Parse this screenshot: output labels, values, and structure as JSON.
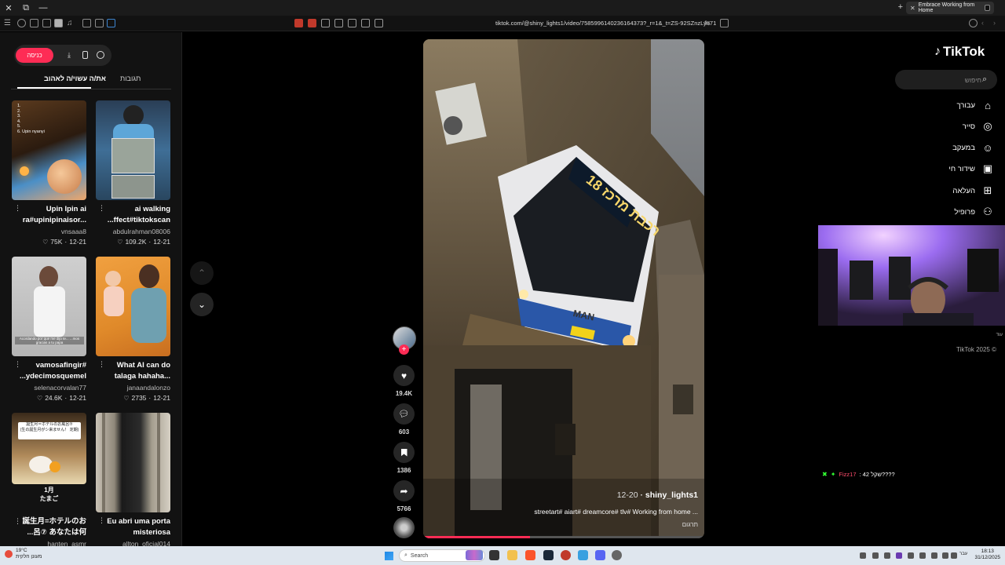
{
  "browser": {
    "tab_title": "Embrace Working from Home",
    "url": "tiktok.com/@shiny_lights1/video/7585996140236164373?_r=1&_t=ZS-92SZnzLyn71"
  },
  "sidebar_left": {
    "login_label": "כניסה",
    "tabs": {
      "liked": "את/ה עשוי/ה לאהוב",
      "replies": "תגובות"
    },
    "cards": [
      {
        "title1": "Upin Ipin ai",
        "title2": "ra#upinipinaisor...",
        "author": "vnsaaa8",
        "date": "12-21",
        "likes": "75K",
        "thumb_text": "1.\n2.\n3.\n4.\n5.\n6. Upin nyanyi"
      },
      {
        "title1": "ai walking",
        "title2": "...ffect#tiktokscan",
        "author": "abdulrahman08006",
        "date": "12-21",
        "likes": "109.2K"
      },
      {
        "title1": "vamosafingir#",
        "title2": "...ydecimosquemel",
        "author": "selenacorvalan77",
        "date": "12-21",
        "likes": "24.6K",
        "thumb_text": "Acordando por que me dijo te... ...mos gracias a tu papa"
      },
      {
        "title1": "What AI can do",
        "title2": "talaga hahaha...",
        "author": "janaandalonzo",
        "date": "12-21",
        "likes": "2735"
      },
      {
        "title1": "1月",
        "title2": "たまご",
        "author": "",
        "date": "",
        "likes": "",
        "thumb_text": "誕生月＝ホテルのお風呂⑦\n(生の誕生月がシ来ません！ 定期)"
      },
      {
        "title1": "Eu abri uma porta",
        "title2": "misteriosa",
        "author": "allton_oficial014",
        "date": "",
        "likes": ""
      },
      {
        "title1": "誕生月=ホテルのお",
        "title2": "...呂⑦ あなたは何",
        "author": "hanten_asmr",
        "date": "",
        "likes": ""
      }
    ]
  },
  "video": {
    "author": "shiny_lights1",
    "date": "12-20",
    "description": "streetart# aiart# dreamcore# tlv# Working from home ...",
    "translate": "תרגום",
    "bus_sign": "18 רכבת מרכז",
    "progress": 0.38
  },
  "actions": {
    "likes": "19.4K",
    "comments": "603",
    "saves": "1386",
    "shares": "5766"
  },
  "right_nav": {
    "logo": "TikTok",
    "search_placeholder": "חיפוש",
    "items": [
      "עבורך",
      "סייר",
      "במעקב",
      "שידור חי",
      "העלאה",
      "פרופיל"
    ],
    "more": "עוד",
    "copyright": "TikTok 2025 ©"
  },
  "chat": {
    "name": "Fizz17",
    "message": ": 42 שקל????"
  },
  "taskbar": {
    "weather_temp": "19°C",
    "weather_desc": "מעונן חלקית",
    "search_label": "Search",
    "time": "18:13",
    "date": "31/12/2025",
    "lang": "עבר"
  }
}
